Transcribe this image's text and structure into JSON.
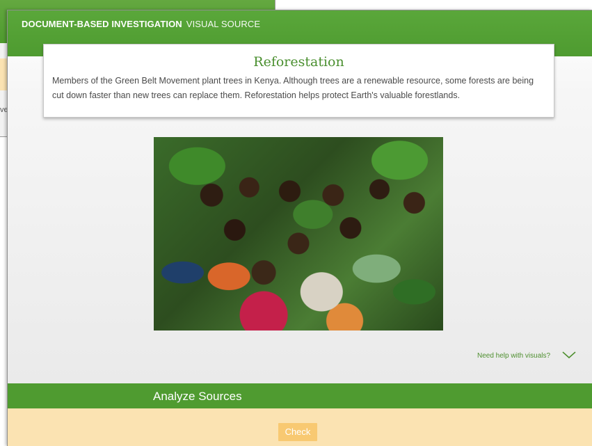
{
  "background_window": {
    "fragment": "ve"
  },
  "header": {
    "title": "DOCUMENT-BASED INVESTIGATION",
    "subtitle": "VISUAL SOURCE"
  },
  "caption": {
    "title": "Reforestation",
    "text": "Members of the Green Belt Movement plant trees in Kenya. Although trees are a renewable resource, some forests are being cut down faster than new trees can replace them. Reforestation helps protect Earth's valuable forestlands."
  },
  "help": {
    "label": "Need help with visuals?",
    "icon": "chevron-down-icon"
  },
  "analyze": {
    "label": "Analyze Sources"
  },
  "check": {
    "label": "Check"
  },
  "colors": {
    "accent_green": "#4f9b30",
    "tan": "#fbe3b2",
    "button": "#f8c972"
  }
}
